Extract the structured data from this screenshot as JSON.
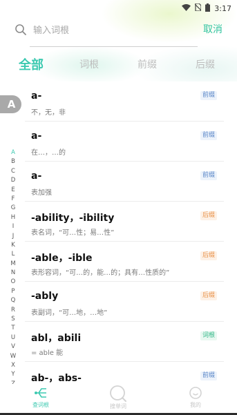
{
  "status": {
    "time": "3:17"
  },
  "search": {
    "placeholder": "输入词根",
    "cancel_label": "取消"
  },
  "tabs": [
    {
      "label": "全部",
      "active": true
    },
    {
      "label": "词根",
      "active": false
    },
    {
      "label": "前缀",
      "active": false
    },
    {
      "label": "后缀",
      "active": false
    }
  ],
  "current_letter": "A",
  "index_letters": [
    "A",
    "B",
    "C",
    "D",
    "E",
    "F",
    "G",
    "H",
    "I",
    "J",
    "K",
    "L",
    "M",
    "N",
    "O",
    "P",
    "Q",
    "R",
    "S",
    "T",
    "U",
    "V",
    "W",
    "X",
    "Y",
    "Z"
  ],
  "entries": [
    {
      "word": "a-",
      "desc": "不，无，非",
      "badge": "前缀",
      "type": "prefix"
    },
    {
      "word": "a-",
      "desc": "在…，…的",
      "badge": "前缀",
      "type": "prefix"
    },
    {
      "word": "a-",
      "desc": "表加强",
      "badge": "前缀",
      "type": "prefix"
    },
    {
      "word": "-ability，-ibility",
      "desc": "表名词，“可…性；易…性”",
      "badge": "后缀",
      "type": "suffix"
    },
    {
      "word": "-able，-ible",
      "desc": "表形容词，“可…的，能…的；具有…性质的”",
      "badge": "后缀",
      "type": "suffix"
    },
    {
      "word": "-ably",
      "desc": "表副词，“可…地，…地”",
      "badge": "后缀",
      "type": "suffix"
    },
    {
      "word": "abl，abili",
      "desc": "= able 能",
      "badge": "词根",
      "type": "root"
    },
    {
      "word": "ab-，abs-",
      "desc": "",
      "badge": "前缀",
      "type": "prefix"
    }
  ],
  "bottom_nav": [
    {
      "label": "查词根",
      "icon": "tree-icon",
      "active": true
    },
    {
      "label": "搜单词",
      "icon": "search-icon",
      "active": false
    },
    {
      "label": "我的",
      "icon": "profile-icon",
      "active": false
    }
  ],
  "colors": {
    "accent": "#3cc9b0",
    "prefix": "#5a87c8",
    "suffix": "#e9924b",
    "root": "#34b889"
  }
}
